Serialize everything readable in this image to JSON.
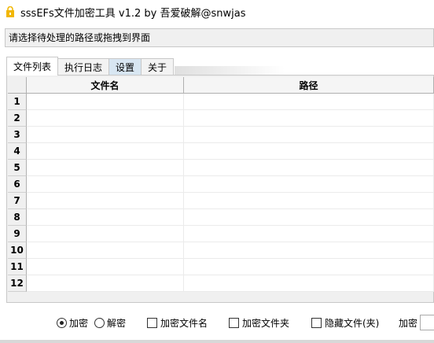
{
  "window": {
    "title": "sssEFs文件加密工具 v1.2 by 吾爱破解@snwjas"
  },
  "path_input": {
    "placeholder": "请选择待处理的路径或拖拽到界面",
    "value": ""
  },
  "tabs": [
    {
      "label": "文件列表",
      "active": true
    },
    {
      "label": "执行日志",
      "active": false
    },
    {
      "label": "设置",
      "active": false
    },
    {
      "label": "关于",
      "active": false
    }
  ],
  "table": {
    "columns": [
      "文件名",
      "路径"
    ],
    "row_numbers": [
      "1",
      "2",
      "3",
      "4",
      "5",
      "6",
      "7",
      "8",
      "9",
      "10",
      "11",
      "12"
    ]
  },
  "options": {
    "encrypt_label": "加密",
    "decrypt_label": "解密",
    "mode_selected": "加密",
    "encrypt_filename_label": "加密文件名",
    "encrypt_folder_label": "加密文件夹",
    "hide_file_label": "隐藏文件(夹)",
    "password_label": "加密"
  },
  "colors": {
    "title_icon": "#f2b705",
    "tab_highlight": "#d8e6f2"
  }
}
